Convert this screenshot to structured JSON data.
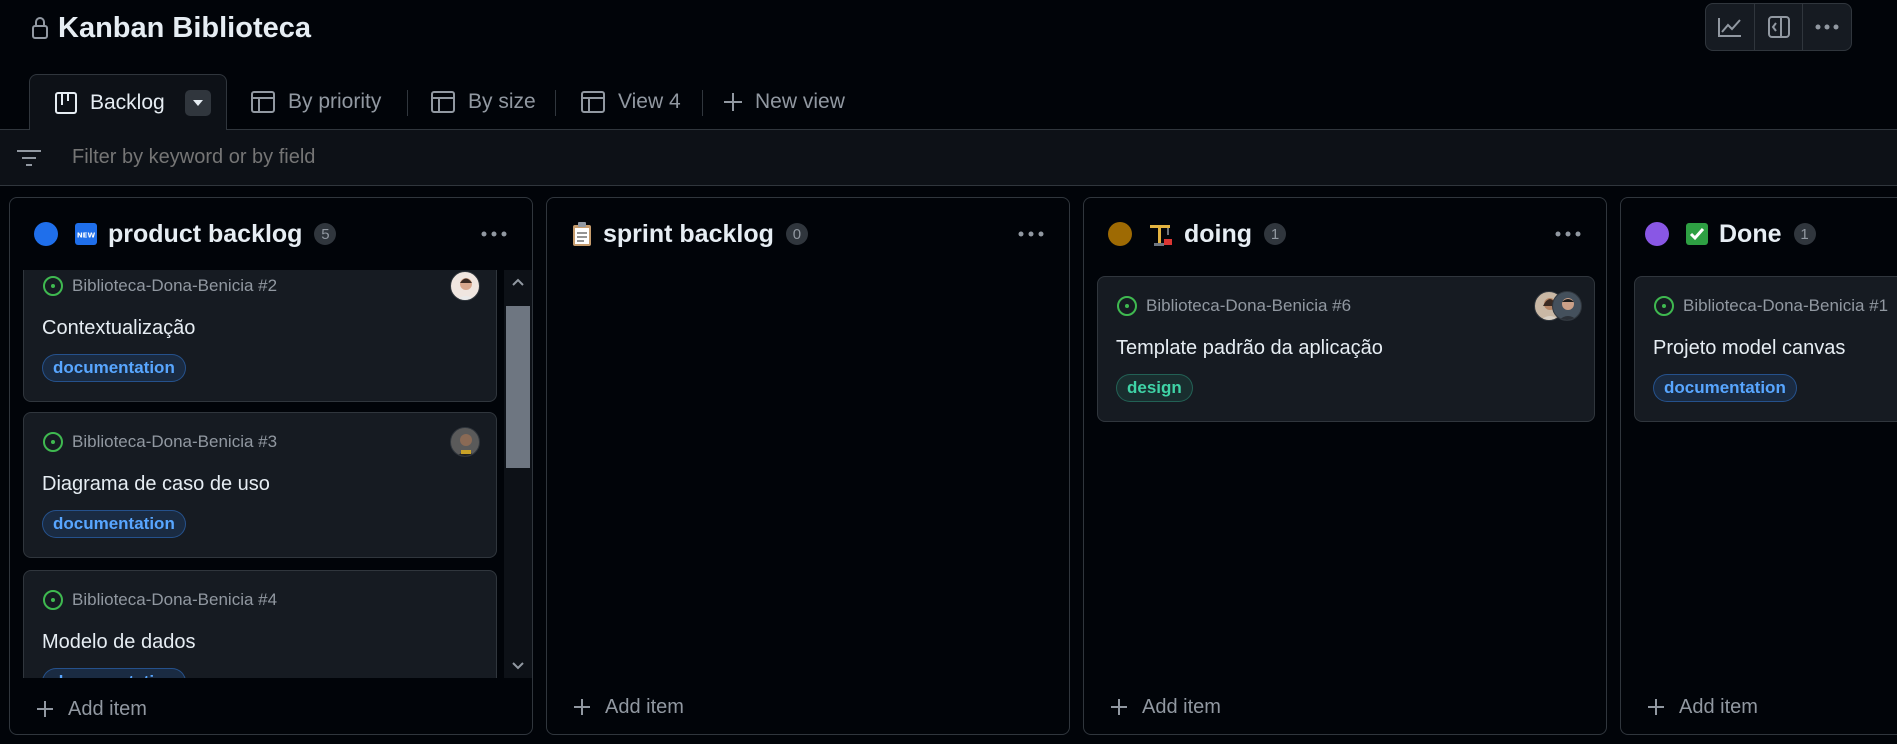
{
  "header": {
    "title": "Kanban Biblioteca",
    "actions": [
      "insights-icon",
      "panel-icon",
      "more-icon"
    ]
  },
  "tabs": [
    {
      "label": "Backlog",
      "icon": "board-icon",
      "active": true
    },
    {
      "label": "By priority",
      "icon": "table-icon"
    },
    {
      "label": "By size",
      "icon": "table-icon"
    },
    {
      "label": "View 4",
      "icon": "table-icon"
    },
    {
      "label": "New view",
      "icon": "plus-icon"
    }
  ],
  "filter": {
    "placeholder": "Filter by keyword or by field"
  },
  "add_item_label": "Add item",
  "colors": {
    "product_backlog": "#1f6feb",
    "doing": "#9e6a03",
    "done": "#8957e5",
    "open_status": "#3fb950"
  },
  "columns": [
    {
      "title": "product backlog",
      "count": "5",
      "emoji": "new-icon",
      "cards": [
        {
          "meta": "Biblioteca-Dona-Benicia #2",
          "title": "Contextualização",
          "label": "documentation"
        },
        {
          "meta": "Biblioteca-Dona-Benicia #3",
          "title": "Diagrama de caso de uso",
          "label": "documentation"
        },
        {
          "meta": "Biblioteca-Dona-Benicia #4",
          "title": "Modelo de dados",
          "label": "documentation"
        }
      ]
    },
    {
      "title": "sprint backlog",
      "count": "0",
      "emoji": "clipboard-icon",
      "cards": []
    },
    {
      "title": "doing",
      "count": "1",
      "emoji": "construction-icon",
      "cards": [
        {
          "meta": "Biblioteca-Dona-Benicia #6",
          "title": "Template padrão da aplicação",
          "label": "design"
        }
      ]
    },
    {
      "title": "Done",
      "count": "1",
      "emoji": "check-icon",
      "cards": [
        {
          "meta": "Biblioteca-Dona-Benicia #1",
          "title": "Projeto model canvas",
          "label": "documentation"
        }
      ]
    }
  ]
}
